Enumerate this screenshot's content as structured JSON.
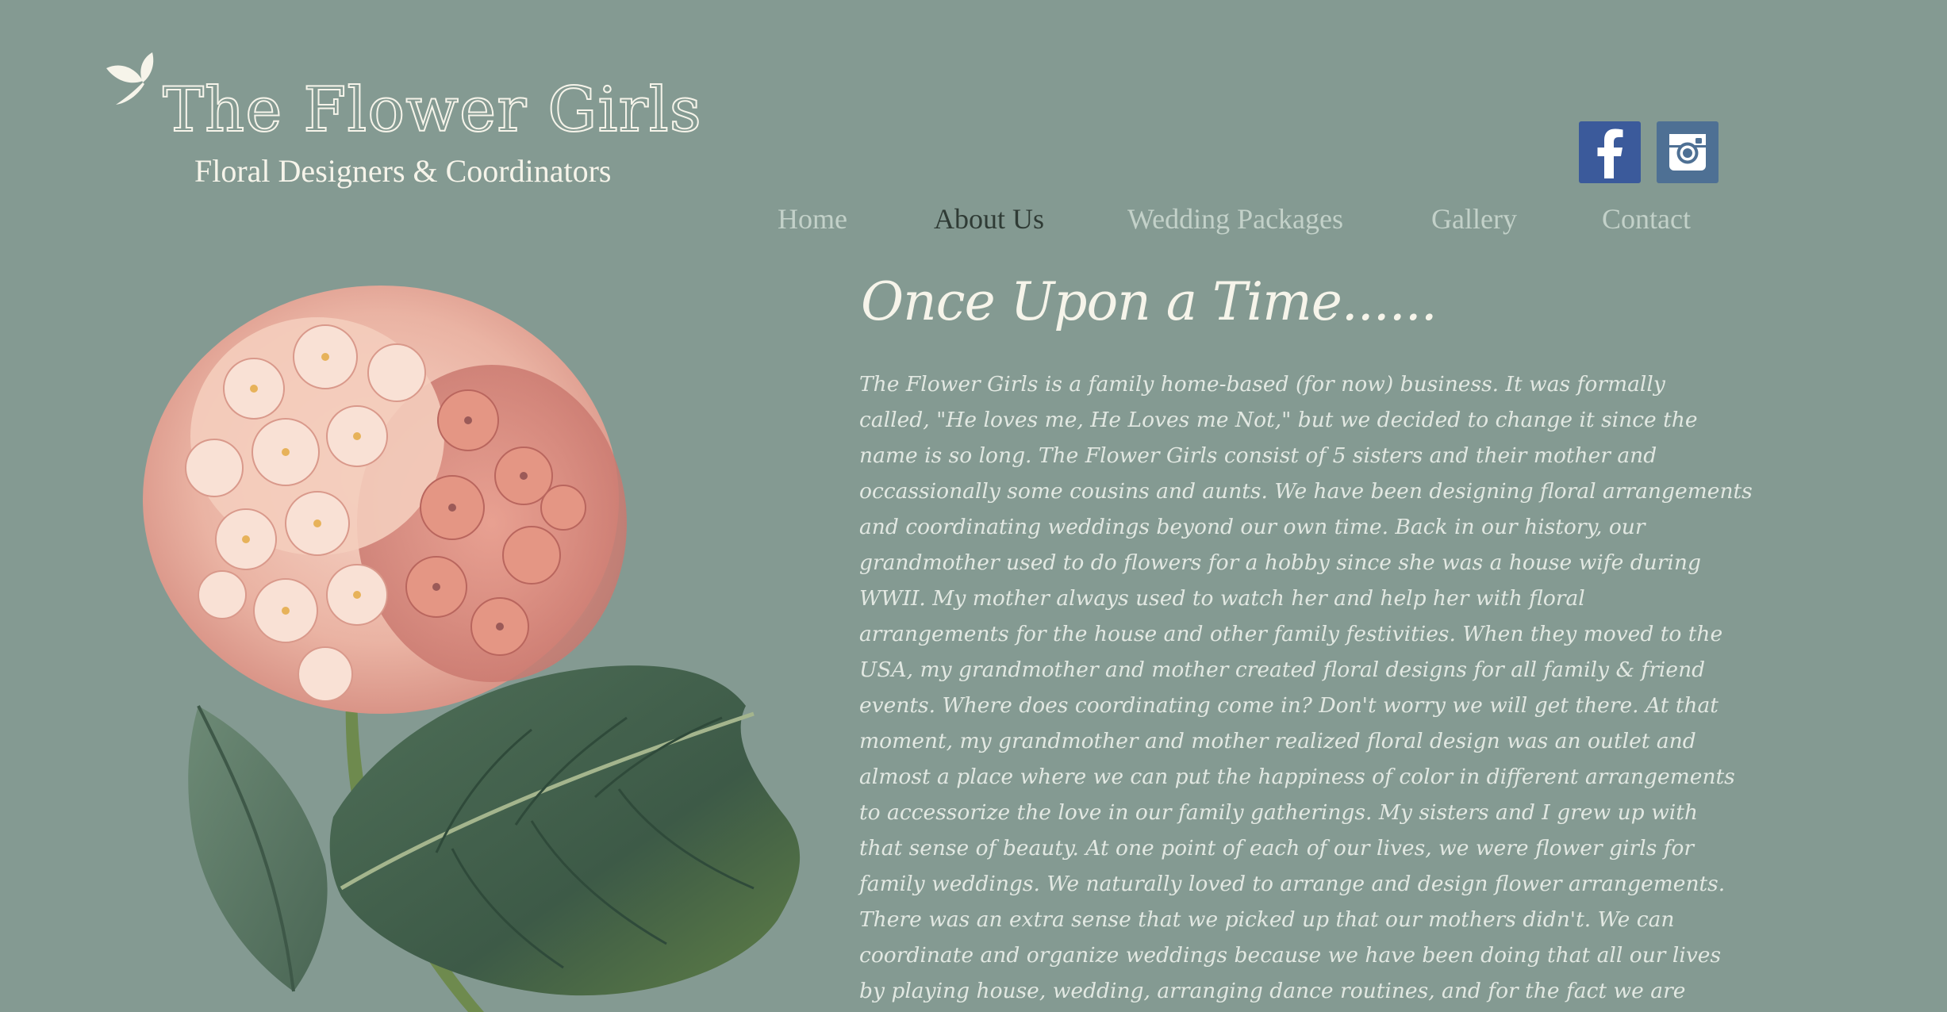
{
  "brand": {
    "title": "The Flower Girls",
    "subtitle": "Floral Designers & Coordinators",
    "logo_icon": "leaf-icon"
  },
  "social": {
    "facebook_icon": "facebook-icon",
    "instagram_icon": "instagram-icon",
    "facebook_color": "#3b5a9b",
    "instagram_color": "#4e7094"
  },
  "nav": {
    "items": [
      {
        "label": "Home"
      },
      {
        "label": "About Us"
      },
      {
        "label": "Wedding Packages"
      },
      {
        "label": "Gallery"
      },
      {
        "label": "Contact"
      }
    ],
    "active": "About Us"
  },
  "content": {
    "heading": "Once Upon a Time......",
    "lines": [
      "The Flower Girls is a family home-based (for now) business. It was formally",
      "called, \"He loves me, He Loves me Not,\" but we decided to change it since the",
      "name is so long. The Flower Girls consist of 5 sisters and their mother and",
      "occassionally some cousins and aunts. We have been designing floral arrangements",
      "and coordinating weddings beyond our own time. Back in our history, our",
      "grandmother used to do flowers for a hobby since she was a house wife during",
      "WWII. My mother always used to watch her and help her with floral",
      "arrangements for the house and other family festivities. When they moved to the",
      "USA, my grandmother and mother created floral designs for all family & friend",
      "events. Where does coordinating come in? Don't worry we will get there. At that",
      "moment, my grandmother and mother realized floral design was an outlet and",
      "almost a place where we can put the happiness of color in different arrangements",
      "to accessorize the love in our family gatherings. My sisters and I grew up with",
      "that sense of beauty. At one point of each of our lives, we were flower girls for",
      "family weddings. We naturally loved to arrange and design flower arrangements.",
      "There was an extra sense that we picked up that our mothers didn't. We can",
      "coordinate and organize weddings because we have been doing that all our lives",
      "by playing house, wedding, arranging dance routines, and for the fact we are"
    ]
  },
  "colors": {
    "background": "#849a92",
    "cream": "#f6f4ea",
    "nav_inactive": "#c3d1c9",
    "nav_active": "#2f3b35"
  }
}
